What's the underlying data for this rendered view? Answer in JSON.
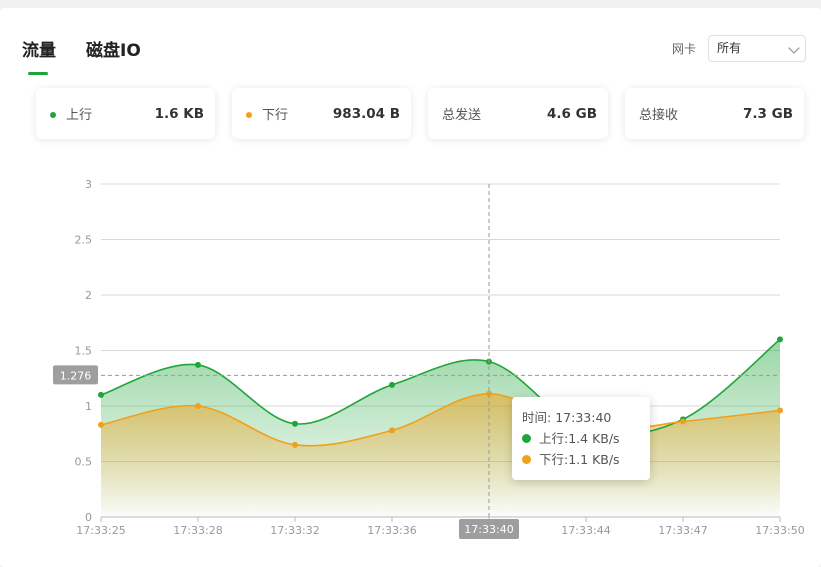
{
  "tabs": [
    {
      "label": "流量"
    },
    {
      "label": "磁盘IO"
    }
  ],
  "nic": {
    "label": "网卡",
    "selected": "所有"
  },
  "stats": [
    {
      "label": "上行",
      "value": "1.6 KB",
      "color": "#20a53a"
    },
    {
      "label": "下行",
      "value": "983.04 B",
      "color": "#f0a11b"
    },
    {
      "label": "总发送",
      "value": "4.6 GB"
    },
    {
      "label": "总接收",
      "value": "7.3 GB"
    }
  ],
  "chart_data": {
    "type": "area",
    "categories": [
      "17:33:25",
      "17:33:28",
      "17:33:32",
      "17:33:36",
      "17:33:40",
      "17:33:44",
      "17:33:47",
      "17:33:50"
    ],
    "series": [
      {
        "name": "上行",
        "color": "#20a53a",
        "values": [
          1.1,
          1.37,
          0.84,
          1.19,
          1.4,
          0.78,
          0.88,
          1.6
        ]
      },
      {
        "name": "下行",
        "color": "#f0a11b",
        "values": [
          0.83,
          1.0,
          0.65,
          0.78,
          1.11,
          0.78,
          0.86,
          0.96
        ]
      }
    ],
    "y_ticks": [
      "0",
      "0.5",
      "1",
      "1.5",
      "2",
      "2.5",
      "3"
    ],
    "ylim": [
      0,
      3
    ],
    "crosshair": {
      "x_label": "17:33:40",
      "y_label": "1.276",
      "y_value": 1.276
    }
  },
  "tooltip": {
    "time_label": "时间:",
    "time": "17:33:40",
    "up_label": "上行:",
    "up_value": "1.4 KB/s",
    "down_label": "下行:",
    "down_value": "1.1 KB/s"
  }
}
